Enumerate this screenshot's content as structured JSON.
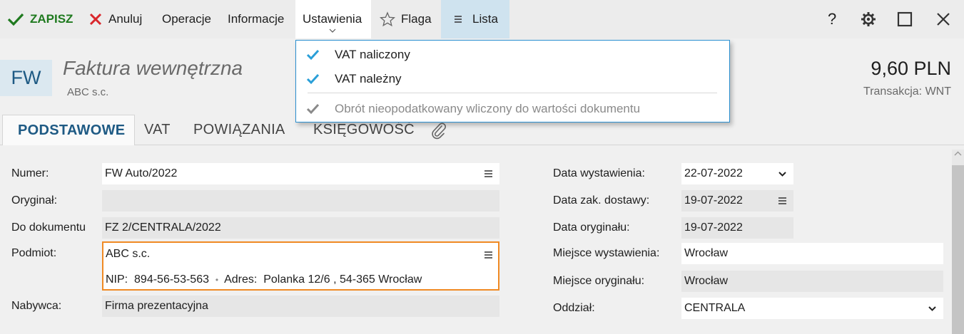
{
  "toolbar": {
    "save": "ZAPISZ",
    "cancel": "Anuluj",
    "operations": "Operacje",
    "information": "Informacje",
    "settings": "Ustawienia",
    "flag": "Flaga",
    "list": "Lista",
    "help": "?",
    "icons": [
      "check-icon",
      "cross-icon",
      "star-icon",
      "list-icon",
      "help-icon",
      "gear-icon",
      "maximize-icon",
      "close-icon"
    ]
  },
  "header": {
    "doc_code": "FW",
    "doc_title": "Faktura wewnętrzna",
    "subtitle": "ABC s.c.",
    "amount": "9,60 PLN",
    "transaction": "Transakcja:  WNT"
  },
  "tabs": [
    {
      "label": "PODSTAWOWE"
    },
    {
      "label": "VAT"
    },
    {
      "label": "POWIĄZANIA"
    },
    {
      "label": "KSIĘGOWOŚĆ"
    }
  ],
  "settings_menu": {
    "items": [
      {
        "label": "VAT naliczony",
        "checked": true,
        "enabled": true
      },
      {
        "label": "VAT należny",
        "checked": true,
        "enabled": true
      },
      {
        "label": "Obrót nieopodatkowany wliczony do wartości dokumentu",
        "checked": true,
        "enabled": false
      }
    ]
  },
  "form_left": {
    "numer_label": "Numer:",
    "numer_value": "FW Auto/2022",
    "oryginal_label": "Oryginał:",
    "oryginal_value": "",
    "do_dok_label": "Do dokumentu",
    "do_dok_value": "FZ 2/CENTRALA/2022",
    "podmiot_label": "Podmiot:",
    "podmiot_name": "ABC s.c.",
    "nip_label": "NIP:",
    "nip_value": "894-56-53-563",
    "adres_label": "Adres:",
    "adres_value": "Polanka  12/6 , 54-365 Wrocław",
    "separator": "•",
    "nabywca_label": "Nabywca:",
    "nabywca_value": "Firma prezentacyjna"
  },
  "form_right": {
    "data_wyst_label": "Data wystawienia:",
    "data_wyst_value": "22-07-2022",
    "data_dost_label": "Data zak. dostawy:",
    "data_dost_value": "19-07-2022",
    "data_oryg_label": "Data oryginału:",
    "data_oryg_value": "19-07-2022",
    "miejsce_wyst_label": "Miejsce wystawienia:",
    "miejsce_wyst_value": "Wrocław",
    "miejsce_oryg_label": "Miejsce oryginału:",
    "miejsce_oryg_value": "Wrocław",
    "oddzial_label": "Oddział:",
    "oddzial_value": "CENTRALA"
  },
  "colors": {
    "accent_blue": "#1e5a84",
    "save_green": "#1f7a1f",
    "cancel_red": "#d9262b",
    "check_blue": "#2a9fd8",
    "highlight_orange": "#f08a24"
  }
}
